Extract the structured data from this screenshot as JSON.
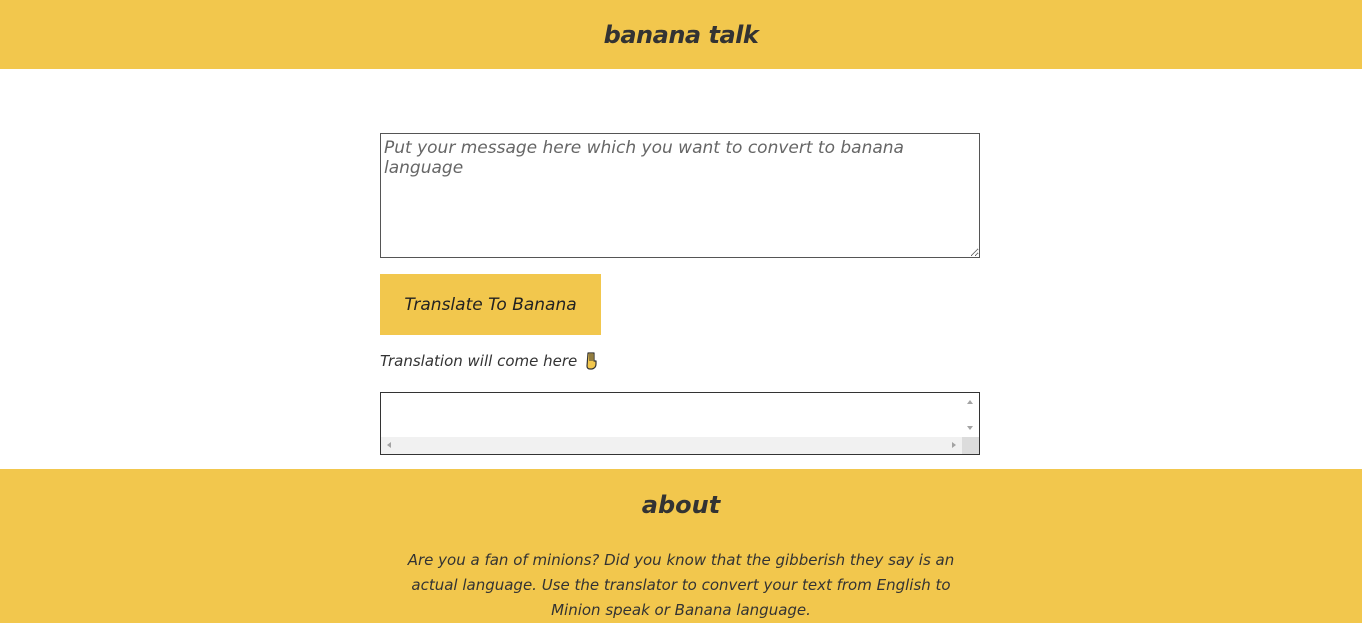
{
  "header": {
    "title": "banana talk"
  },
  "input": {
    "placeholder": "Put your message here which you want to convert to banana language",
    "value": ""
  },
  "translate_button": {
    "label": "Translate To Banana"
  },
  "output": {
    "label": "Translation will come here",
    "pointer_icon": "pointing-down-hand-icon",
    "value": ""
  },
  "about": {
    "title": "about",
    "text": "Are you a fan of minions? Did you know that the gibberish they say is an actual language. Use the translator to convert your text from English to Minion speak or Banana language."
  },
  "colors": {
    "accent": "#F2C74D",
    "text": "#333333",
    "background": "#FFFFFF"
  }
}
